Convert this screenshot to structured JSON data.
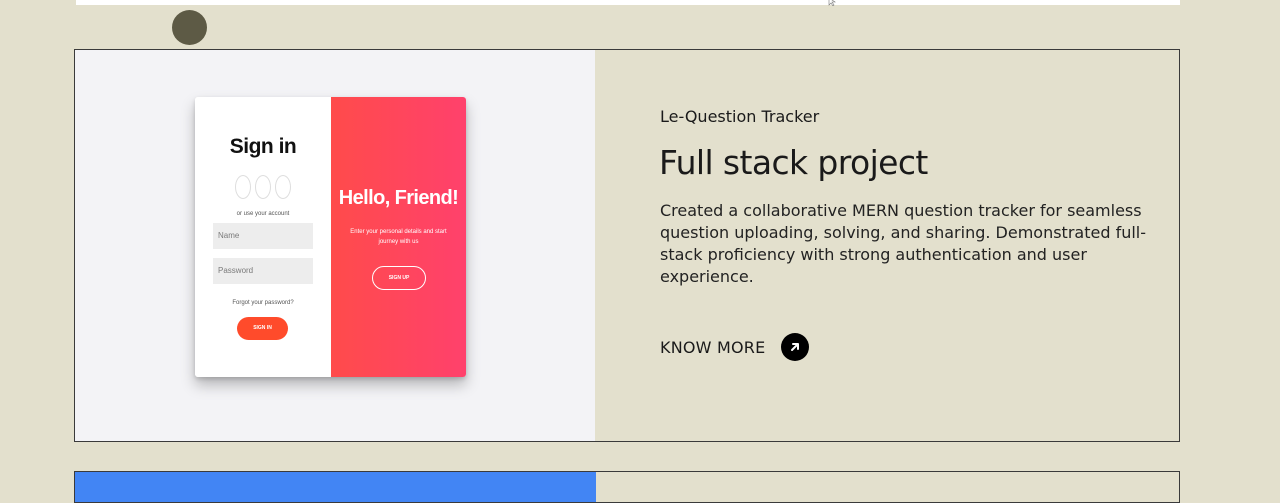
{
  "project": {
    "subtitle": "Le-Question Tracker",
    "title": "Full stack project",
    "description": "Created a collaborative MERN question tracker for seamless question uploading, solving, and sharing. Demonstrated full-stack proficiency with strong authentication and user experience.",
    "cta_label": "KNOW MORE",
    "cta_icon": "arrow-up-right-icon"
  },
  "preview": {
    "signin_title": "Sign in",
    "use_account_text": "or use your account",
    "name_placeholder": "Name",
    "password_placeholder": "Password",
    "forgot_text": "Forgot your password?",
    "signin_button": "SIGN IN",
    "hello_title": "Hello, Friend!",
    "hello_text": "Enter your personal details and start journey with us",
    "signup_button": "SIGN UP"
  },
  "colors": {
    "page_background": "#e3e0cd",
    "preview_background": "#f3f3f6",
    "accent_red": "#ff4b2b",
    "next_preview_blue": "#4285f4",
    "dot": "#5d5a45"
  }
}
